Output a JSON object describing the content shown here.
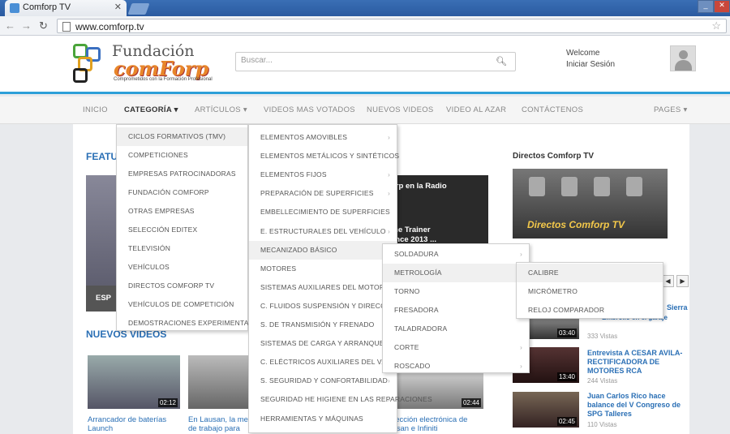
{
  "browser": {
    "tab_title": "Comforp TV",
    "tab_close": "✕",
    "url": "www.comforp.tv",
    "win_min": "_",
    "win_close": "✕"
  },
  "header": {
    "logo_line1": "Fundación",
    "logo_line2": "comForp",
    "logo_tagline": "Comprometidos con la Formación Profesional",
    "search_placeholder": "Buscar...",
    "welcome": "Welcome",
    "login": "Iniciar Sesión"
  },
  "menu": {
    "items": [
      "INICIO",
      "CATEGORÍA ▾",
      "ARTÍCULOS ▾",
      "VIDEOS MAS VOTADOS",
      "NUEVOS VIDEOS",
      "VIDEO AL AZAR",
      "CONTÁCTENOS",
      "PAGES ▾"
    ]
  },
  "main": {
    "featured_title": "FEATU",
    "banner_fragment": "ESP",
    "news_frag1": "orp en la Radio",
    "news_frag2": "the Trainer",
    "news_frag3": "ence 2013 ...",
    "nuevos_videos": "NUEVOS VIDEOS",
    "videos": [
      {
        "duration": "02:12",
        "caption": "Arrancador de baterías Launch"
      },
      {
        "duration": "",
        "caption": "En Lausan, la me de trabajo para"
      },
      {
        "duration": "02:44",
        "caption": "rección electrónica de ssan e Infiniti"
      }
    ]
  },
  "sidebar": {
    "live_title": "Directos Comforp TV",
    "live_label": "Directos Comforp TV",
    "nav_prev": "◀",
    "nav_next": "▶",
    "frag1": "Sierra",
    "frag2": "Embrollo en el garaje",
    "views0": "333 Vistas",
    "items": [
      {
        "duration": "03:40",
        "title": "",
        "views": ""
      },
      {
        "duration": "13:40",
        "title": "Entrevista A CESAR AVILA-RECTIFICADORA DE MOTORES RCA",
        "views": "244 Vistas"
      },
      {
        "duration": "02:45",
        "title": "Juan Carlos Rico hace balance del V Congreso de SPG Talleres",
        "views": "110 Vistas"
      }
    ]
  },
  "dropdown_l1": [
    "CICLOS FORMATIVOS (TMV)",
    "COMPETICIONES",
    "EMPRESAS PATROCINADORAS",
    "FUNDACIÓN COMFORP",
    "OTRAS EMPRESAS",
    "SELECCIÓN EDITEX",
    "TELEVISIÓN",
    "VEHÍCULOS",
    "DIRECTOS COMFORP TV",
    "VEHÍCULOS DE COMPETICIÓN",
    "DEMOSTRACIONES EXPERIMENTALES"
  ],
  "dropdown_l2": [
    "ELEMENTOS AMOVIBLES",
    "ELEMENTOS METÁLICOS Y SINTÉTICOS",
    "ELEMENTOS FIJOS",
    "PREPARACIÓN DE SUPERFICIES",
    "EMBELLECIMIENTO DE SUPERFICIES",
    "E. ESTRUCTURALES DEL VEHÍCULO",
    "MECANIZADO BÁSICO",
    "MOTORES",
    "SISTEMAS AUXILIARES DEL MOTOR",
    "C. FLUIDOS SUSPENSIÓN Y DIRECCIÓN",
    "S. DE TRANSMISIÓN Y FRENADO",
    "SISTEMAS DE CARGA Y ARRANQUE",
    "C. ELÉCTRICOS AUXILIARES DEL V.",
    "S. SEGURIDAD Y CONFORTABILIDAD",
    "SEGURIDAD HE HIGIENE EN LAS REPARACIONES",
    "HERRAMIENTAS Y MÁQUINAS"
  ],
  "dropdown_l3": [
    "SOLDADURA",
    "METROLOGÍA",
    "TORNO",
    "FRESADORA",
    "TALADRADORA",
    "CORTE",
    "ROSCADO"
  ],
  "dropdown_l4": [
    "CALIBRE",
    "MICRÓMETRO",
    "RELOJ COMPARADOR"
  ],
  "caret": "›"
}
